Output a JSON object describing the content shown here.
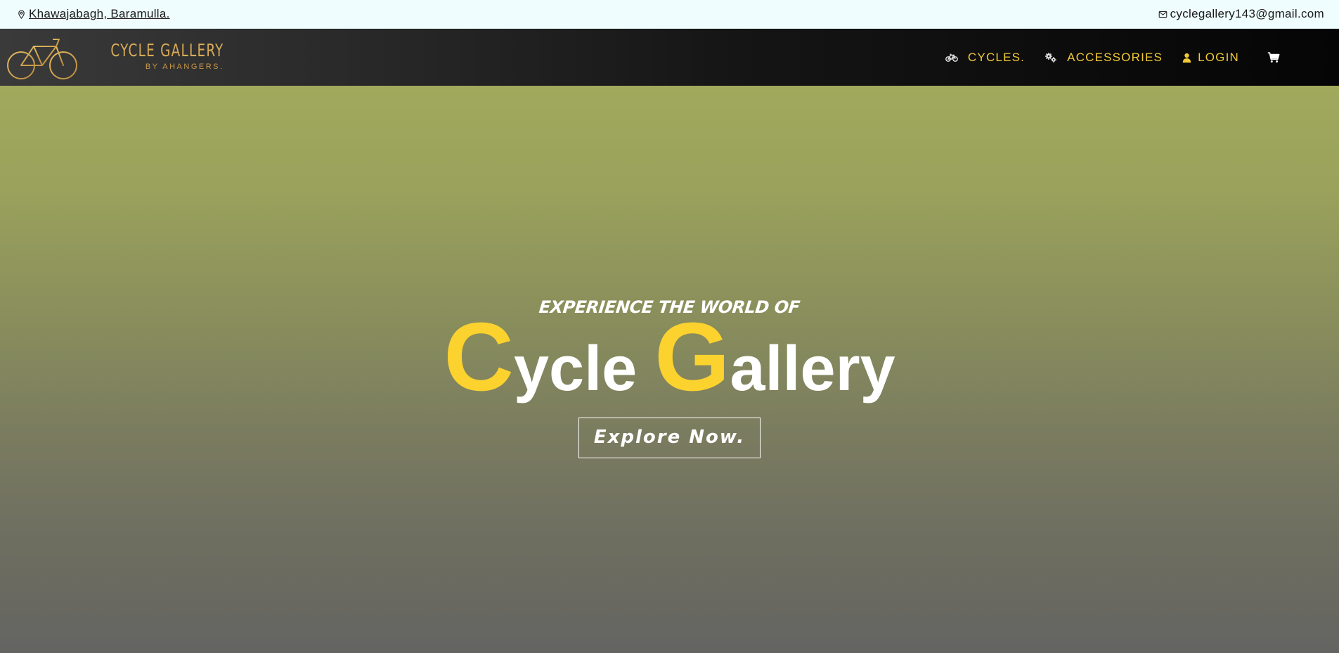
{
  "topbar": {
    "address": "Khawajabagh, Baramulla.",
    "email": "cyclegallery143@gmail.com"
  },
  "navbar": {
    "brand_name": "CYCLE GALLERY",
    "brand_sub": "BY AHANGERS.",
    "items": [
      {
        "label": "CYCLES.",
        "icon": "bicycle-icon"
      },
      {
        "label": "ACCESSORIES",
        "icon": "gears-icon"
      },
      {
        "label": "LOGIN",
        "icon": "user-icon"
      }
    ],
    "cart_icon": "cart-icon"
  },
  "hero": {
    "tagline": "EXPERIENCE THE WORLD OF",
    "title_cap_1": "C",
    "title_rest_1": "ycle ",
    "title_cap_2": "G",
    "title_rest_2": "allery",
    "button_label": "Explore Now."
  },
  "colors": {
    "accent_yellow": "#fcd22e",
    "nav_gold": "#f3c936",
    "brand_gold": "#d7aa58",
    "topbar_bg": "#effdff"
  }
}
